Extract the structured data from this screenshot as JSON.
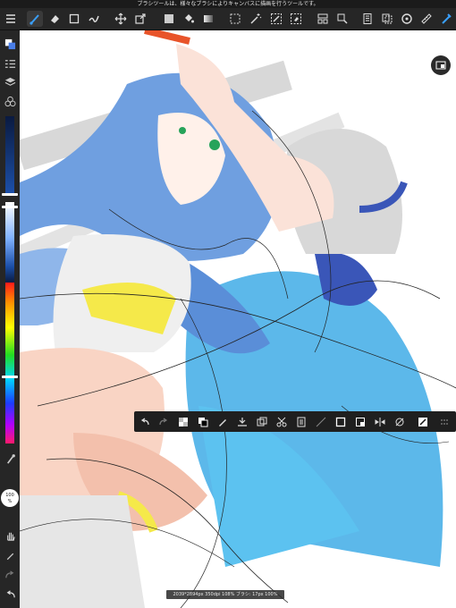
{
  "tooltip": {
    "text": "ブラシツールは、様々なブラシによりキャンバスに描画を行うツールです。"
  },
  "toolbar": {
    "tools": [
      {
        "name": "menu-icon"
      },
      {
        "name": "brush-icon",
        "active": true
      },
      {
        "name": "eraser-icon"
      },
      {
        "name": "rectangle-tool-icon"
      },
      {
        "name": "smudge-icon"
      },
      {
        "name": "move-icon"
      },
      {
        "name": "transform-icon"
      },
      {
        "name": "fill-color-icon"
      },
      {
        "name": "bucket-icon"
      },
      {
        "name": "gradient-icon"
      },
      {
        "name": "select-icon"
      },
      {
        "name": "magic-wand-icon"
      },
      {
        "name": "select-pen-icon"
      },
      {
        "name": "select-eraser-icon"
      },
      {
        "name": "frame-divider-icon"
      },
      {
        "name": "text-icon"
      },
      {
        "name": "panel-icon"
      },
      {
        "name": "copy-icon"
      },
      {
        "name": "snap-icon"
      },
      {
        "name": "ruler-icon"
      },
      {
        "name": "stabilizer-icon"
      }
    ]
  },
  "sidebar": {
    "zoom_label": "100\n%",
    "zoom_line1": "100",
    "zoom_line2": "%"
  },
  "selection_bar": {
    "items": [
      "undo",
      "redo",
      "fill",
      "swap-color",
      "pen",
      "import",
      "duplicate",
      "cut",
      "paste",
      "clear",
      "invert",
      "select-layer",
      "flip",
      "rotate",
      "transform",
      "more"
    ]
  },
  "status": {
    "text": "2039*2894px 350dpi 108% ブラシ: 17px 100%"
  },
  "colors": {
    "toolbar_bg": "#262626",
    "accent": "#3aa0ff",
    "hair": "#6f9fe0",
    "cape": "#4ab0e8"
  }
}
